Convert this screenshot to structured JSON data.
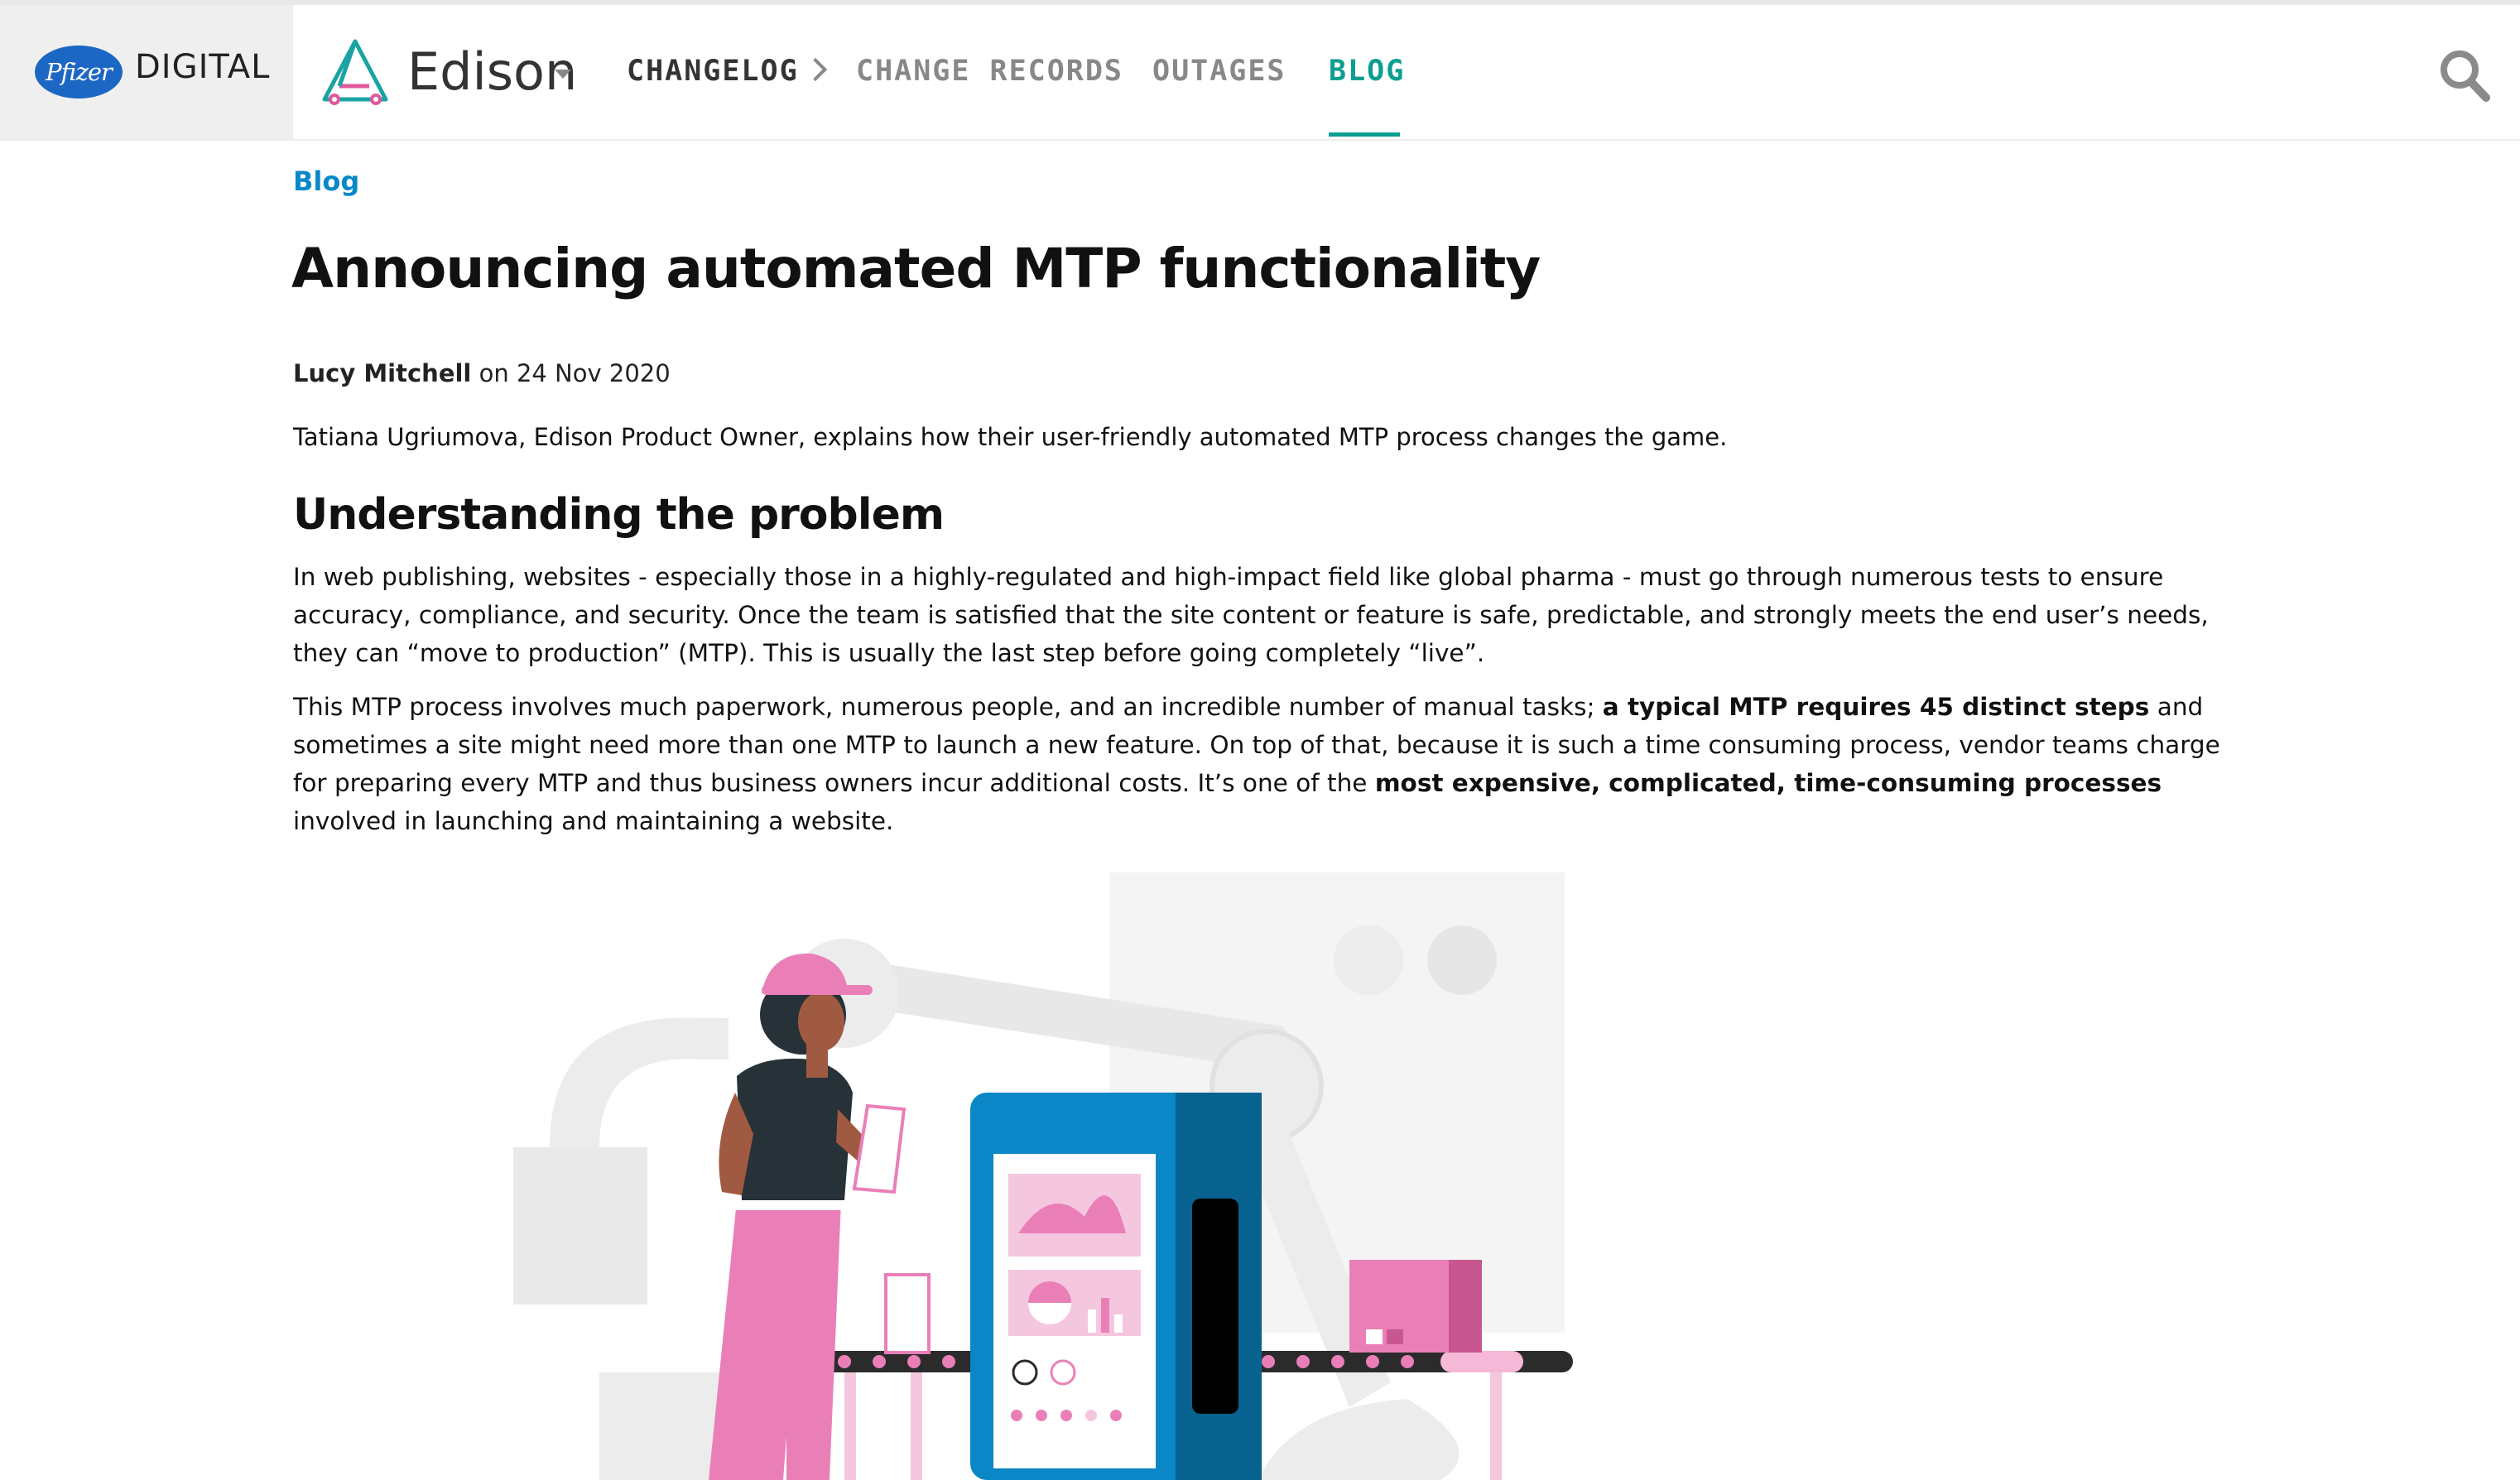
{
  "header": {
    "brand_logo": "Pfizer",
    "brand_suffix": "DIGITAL",
    "app_name": "Edison",
    "nav": [
      {
        "label": "CHANGELOG"
      },
      {
        "label": "CHANGE RECORDS"
      },
      {
        "label": "OUTAGES"
      },
      {
        "label": "BLOG",
        "active": true
      }
    ],
    "search_icon": "search-icon"
  },
  "article": {
    "breadcrumb": "Blog",
    "title": "Announcing automated MTP functionality",
    "author": "Lucy Mitchell",
    "date_prefix": "on",
    "date": "24 Nov 2020",
    "intro": "Tatiana Ugriumova, Edison Product Owner, explains how their user-friendly automated MTP process changes the game.",
    "section_heading": "Understanding the problem",
    "paragraph1": "In web publishing, websites - especially those in a highly-regulated and high-impact field like global pharma - must go through numerous tests to ensure accuracy, compliance, and security. Once the team is satisfied that the site content or feature is safe, predictable, and strongly meets the end user’s needs, they can “move to production” (MTP). This is usually the last step before going completely “live”.",
    "paragraph2": {
      "part1": "This MTP process involves much paperwork, numerous people, and an incredible number of manual tasks; ",
      "bold1": "a typical MTP requires 45 distinct steps",
      "part2": " and sometimes a site might need more than one MTP to launch a new feature. On top of that, because it is such a time consuming process, vendor teams charge for preparing every MTP and thus business owners incur additional costs. It’s one of the ",
      "bold2": "most expensive, complicated, time-consuming processes",
      "part3": " involved in launching and maintaining a website."
    }
  },
  "colors": {
    "accent": "#0b9e90",
    "link": "#0a87c9",
    "pfizer_blue": "#1d67c4",
    "pink": "#ea7fb8",
    "machine_blue": "#0b86c6"
  }
}
